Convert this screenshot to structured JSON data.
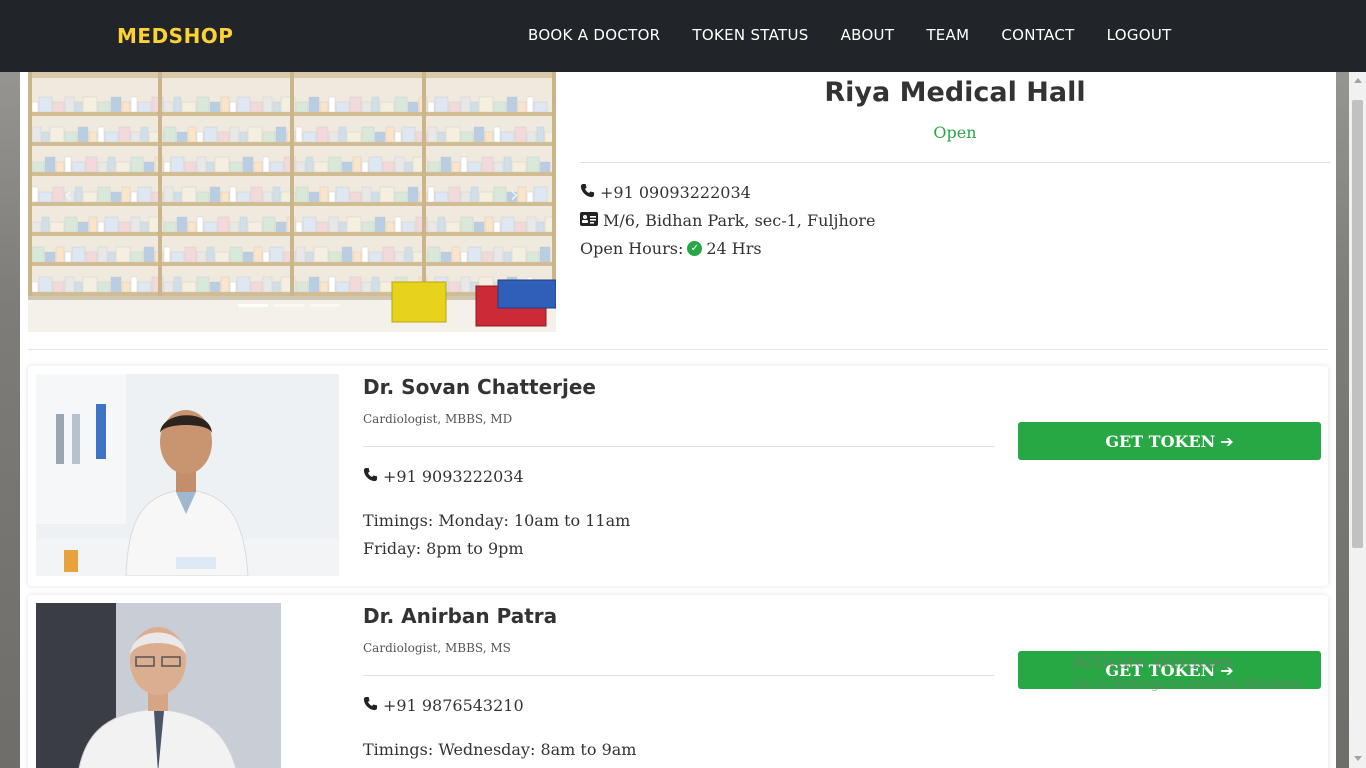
{
  "brand": "MEDSHOP",
  "nav": [
    "BOOK A DOCTOR",
    "TOKEN STATUS",
    "ABOUT",
    "TEAM",
    "CONTACT",
    "LOGOUT"
  ],
  "shop": {
    "name": "Riya Medical Hall",
    "status": "Open",
    "phone": "+91 09093222034",
    "address": "M/6, Bidhan Park, sec-1, Fuljhore",
    "hours_label": "Open Hours:",
    "hours_value": "24 Hrs"
  },
  "doctors": [
    {
      "name": "Dr. Sovan Chatterjee",
      "spec": "Cardiologist, MBBS, MD",
      "phone": "+91 9093222034",
      "timings1": "Timings: Monday: 10am to 11am",
      "timings2": "Friday: 8pm to 9pm",
      "button": "GET TOKEN"
    },
    {
      "name": "Dr. Anirban Patra",
      "spec": "Cardiologist, MBBS, MS",
      "phone": "+91 9876543210",
      "timings1": "Timings: Wednesday: 8am to 9am",
      "button": "GET TOKEN"
    }
  ],
  "watermark": {
    "line1": "Activate Windows",
    "line2": "Go to Settings to activate Windows."
  },
  "colors": {
    "navbar": "#212529",
    "brand": "#fed136",
    "success": "#28a745"
  },
  "icons": [
    "phone-icon",
    "address-card-icon",
    "check-circle-icon",
    "arrow-right-icon"
  ]
}
